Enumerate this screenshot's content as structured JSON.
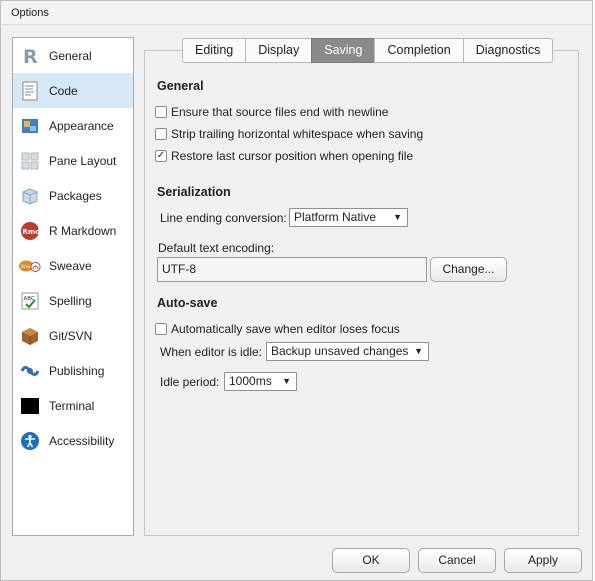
{
  "window": {
    "title": "Options"
  },
  "sidebar": {
    "items": [
      {
        "label": "General",
        "icon": "r-logo-icon",
        "selected": false
      },
      {
        "label": "Code",
        "icon": "code-document-icon",
        "selected": true
      },
      {
        "label": "Appearance",
        "icon": "appearance-paint-icon",
        "selected": false
      },
      {
        "label": "Pane Layout",
        "icon": "pane-layout-icon",
        "selected": false
      },
      {
        "label": "Packages",
        "icon": "package-box-icon",
        "selected": false
      },
      {
        "label": "R Markdown",
        "icon": "rmd-icon",
        "selected": false
      },
      {
        "label": "Sweave",
        "icon": "sweave-icon",
        "selected": false
      },
      {
        "label": "Spelling",
        "icon": "spelling-abc-check-icon",
        "selected": false
      },
      {
        "label": "Git/SVN",
        "icon": "git-svn-box-icon",
        "selected": false
      },
      {
        "label": "Publishing",
        "icon": "publishing-icon",
        "selected": false
      },
      {
        "label": "Terminal",
        "icon": "terminal-icon",
        "selected": false
      },
      {
        "label": "Accessibility",
        "icon": "accessibility-icon",
        "selected": false
      }
    ]
  },
  "tabs": [
    {
      "label": "Editing",
      "active": false
    },
    {
      "label": "Display",
      "active": false
    },
    {
      "label": "Saving",
      "active": true
    },
    {
      "label": "Completion",
      "active": false
    },
    {
      "label": "Diagnostics",
      "active": false
    }
  ],
  "general": {
    "title": "General",
    "ensure_newline": {
      "label": "Ensure that source files end with newline",
      "checked": false
    },
    "strip_whitespace": {
      "label": "Strip trailing horizontal whitespace when saving",
      "checked": false
    },
    "restore_cursor": {
      "label": "Restore last cursor position when opening file",
      "checked": true
    }
  },
  "serialization": {
    "title": "Serialization",
    "line_ending_label": "Line ending conversion:",
    "line_ending_value": "Platform Native",
    "encoding_label": "Default text encoding:",
    "encoding_value": "UTF-8",
    "change_button": "Change..."
  },
  "autosave": {
    "title": "Auto-save",
    "lose_focus": {
      "label": "Automatically save when editor loses focus",
      "checked": false
    },
    "idle_label": "When editor is idle:",
    "idle_value": "Backup unsaved changes",
    "period_label": "Idle period:",
    "period_value": "1000ms"
  },
  "footer": {
    "ok": "OK",
    "cancel": "Cancel",
    "apply": "Apply"
  },
  "colors": {
    "selected_bg": "#d6e7f6",
    "active_tab": "#8a8a8a",
    "window_bg": "#f0f0f0"
  },
  "dropdown_arrow": "▼",
  "check_mark": "✓"
}
